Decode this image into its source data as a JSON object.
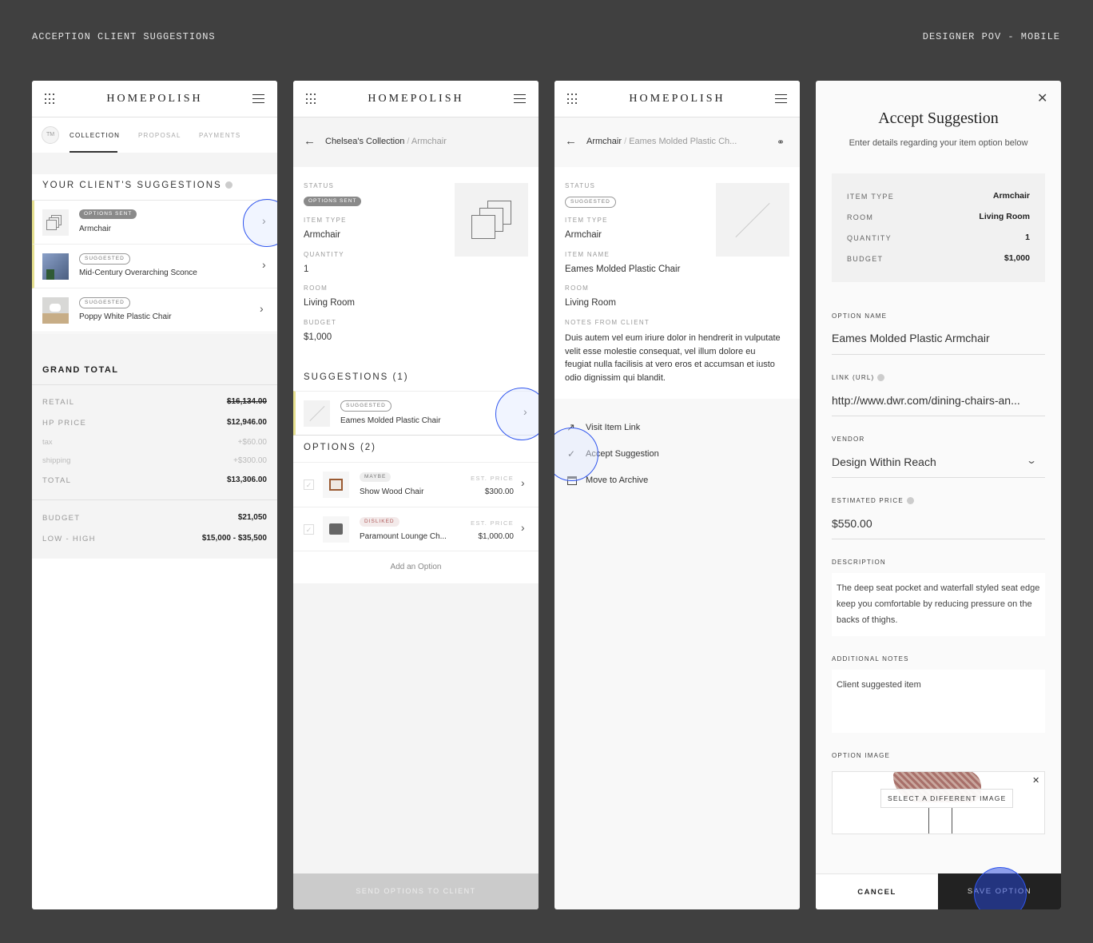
{
  "page": {
    "title_left": "ACCEPTION CLIENT SUGGESTIONS",
    "title_right": "DESIGNER POV - MOBILE"
  },
  "app": {
    "logo": "HOMEPOLISH"
  },
  "panel1": {
    "avatar": "TM",
    "tabs": [
      "COLLECTION",
      "PROPOSAL",
      "PAYMENTS"
    ],
    "section_title": "YOUR CLIENT'S SUGGESTIONS",
    "items": [
      {
        "status": "OPTIONS SENT",
        "name": "Armchair"
      },
      {
        "status": "SUGGESTED",
        "name": "Mid-Century Overarching Sconce"
      },
      {
        "status": "SUGGESTED",
        "name": "Poppy White Plastic Chair"
      }
    ],
    "grand_total_title": "GRAND TOTAL",
    "totals": [
      {
        "label": "RETAIL",
        "value": "$16,134.00"
      },
      {
        "label": "HP PRICE",
        "value": "$12,946.00"
      },
      {
        "label": "tax",
        "value": "+$60.00"
      },
      {
        "label": "shipping",
        "value": "+$300.00"
      },
      {
        "label": "TOTAL",
        "value": "$13,306.00"
      }
    ],
    "budget": [
      {
        "label": "BUDGET",
        "value": "$21,050"
      },
      {
        "label": "LOW - HIGH",
        "value": "$15,000 - $35,500"
      }
    ]
  },
  "panel2": {
    "breadcrumb": {
      "parent": "Chelsea's Collection",
      "current": "Armchair"
    },
    "status_label": "STATUS",
    "status": "OPTIONS SENT",
    "item_type_label": "ITEM TYPE",
    "item_type": "Armchair",
    "quantity_label": "QUANTITY",
    "quantity": "1",
    "room_label": "ROOM",
    "room": "Living Room",
    "budget_label": "BUDGET",
    "budget": "$1,000",
    "suggestions_title": "SUGGESTIONS (1)",
    "suggestion": {
      "status": "SUGGESTED",
      "name": "Eames Molded Plastic Chair"
    },
    "options_title": "OPTIONS (2)",
    "options": [
      {
        "status": "MAYBE",
        "name": "Show Wood Chair",
        "price_label": "EST. PRICE",
        "price": "$300.00"
      },
      {
        "status": "DISLIKED",
        "name": "Paramount Lounge Ch...",
        "price_label": "EST. PRICE",
        "price": "$1,000.00"
      }
    ],
    "add_option": "Add an Option",
    "send_button": "SEND OPTIONS TO CLIENT"
  },
  "panel3": {
    "breadcrumb": {
      "parent": "Armchair",
      "current": "Eames Molded Plastic Ch..."
    },
    "status_label": "STATUS",
    "status": "SUGGESTED",
    "item_type_label": "ITEM TYPE",
    "item_type": "Armchair",
    "item_name_label": "ITEM NAME",
    "item_name": "Eames Molded Plastic Chair",
    "room_label": "ROOM",
    "room": "Living Room",
    "notes_label": "NOTES FROM CLIENT",
    "notes": "Duis autem vel eum iriure dolor in hendrerit in vulputate velit esse molestie consequat, vel illum dolore eu feugiat nulla facilisis at vero eros et accumsan et iusto odio dignissim qui blandit.",
    "actions": [
      "Visit Item Link",
      "Accept Suggestion",
      "Move to Archive"
    ]
  },
  "panel4": {
    "title": "Accept Suggestion",
    "subtitle": "Enter details regarding your item option below",
    "summary": [
      {
        "label": "ITEM TYPE",
        "value": "Armchair"
      },
      {
        "label": "ROOM",
        "value": "Living Room"
      },
      {
        "label": "QUANTITY",
        "value": "1"
      },
      {
        "label": "BUDGET",
        "value": "$1,000"
      }
    ],
    "option_name_label": "OPTION NAME",
    "option_name": "Eames Molded Plastic Armchair",
    "link_label": "LINK (URL)",
    "link": "http://www.dwr.com/dining-chairs-an...",
    "vendor_label": "VENDOR",
    "vendor": "Design Within Reach",
    "price_label": "ESTIMATED PRICE",
    "price": "$550.00",
    "description_label": "DESCRIPTION",
    "description": "The deep seat pocket and waterfall styled seat edge keep you comfortable by reducing pressure on the backs of thighs.",
    "notes_label": "ADDITIONAL NOTES",
    "notes": "Client suggested item",
    "image_label": "OPTION IMAGE",
    "image_button": "SELECT A DIFFERENT IMAGE",
    "cancel": "CANCEL",
    "save": "SAVE OPTION"
  },
  "colors": {
    "background": "#404040",
    "accent_bar": "#e6e08f",
    "touch": "#2f55ee",
    "disliked": "#b05a5a"
  }
}
